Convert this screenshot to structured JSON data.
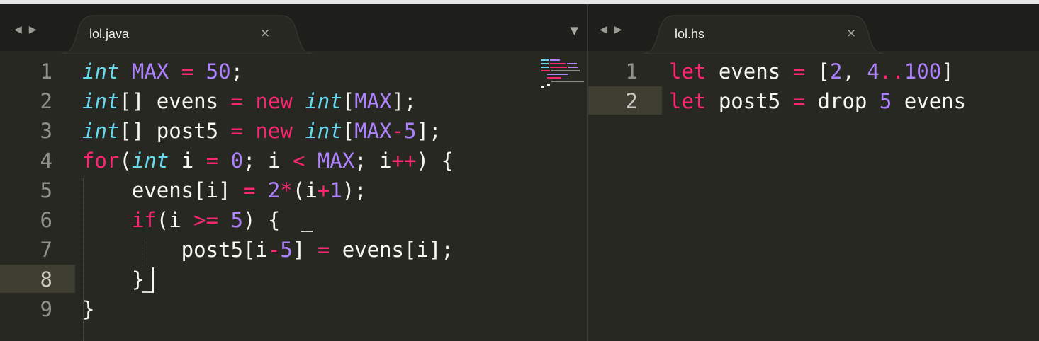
{
  "left_pane": {
    "tab_title": "lol.java",
    "close_glyph": "×",
    "nav_back_glyph": "◀",
    "nav_forward_glyph": "▶",
    "dropdown_glyph": "▼",
    "line_numbers": [
      "1",
      "2",
      "3",
      "4",
      "5",
      "6",
      "7",
      "8",
      "9"
    ],
    "current_line": "8"
  },
  "right_pane": {
    "tab_title": "lol.hs",
    "close_glyph": "×",
    "nav_back_glyph": "◀",
    "nav_forward_glyph": "▶",
    "line_numbers": [
      "1",
      "2"
    ],
    "current_line": "2"
  },
  "java_code": {
    "l1": {
      "t1": "int",
      "t2": " ",
      "t3": "MAX",
      "t4": " ",
      "t5": "=",
      "t6": " ",
      "t7": "50",
      "t8": ";"
    },
    "l2": {
      "t1": "int",
      "t2": "[] evens ",
      "t3": "=",
      "t4": " ",
      "t5": "new",
      "t6": " ",
      "t7": "int",
      "t8": "[",
      "t9": "MAX",
      "t10": "];"
    },
    "l3": {
      "t1": "int",
      "t2": "[] post5 ",
      "t3": "=",
      "t4": " ",
      "t5": "new",
      "t6": " ",
      "t7": "int",
      "t8": "[",
      "t9": "MAX",
      "t10": "-",
      "t11": "5",
      "t12": "];"
    },
    "l4": {
      "t1": "for",
      "t2": "(",
      "t3": "int",
      "t4": " i ",
      "t5": "=",
      "t6": " ",
      "t7": "0",
      "t8": "; i ",
      "t9": "<",
      "t10": " ",
      "t11": "MAX",
      "t12": "; i",
      "t13": "++",
      "t14": ") {"
    },
    "l5": {
      "t1": "    evens[i] ",
      "t2": "=",
      "t3": " ",
      "t4": "2",
      "t5": "*",
      "t6": "(i",
      "t7": "+",
      "t8": "1",
      "t9": ");"
    },
    "l6": {
      "t1": "    ",
      "t2": "if",
      "t3": "(i ",
      "t4": ">=",
      "t5": " ",
      "t6": "5",
      "t7": ") {"
    },
    "l7": {
      "t1": "        post5[i",
      "t2": "-",
      "t3": "5",
      "t4": "] ",
      "t5": "=",
      "t6": " evens[i];"
    },
    "l8": {
      "t1": "    }"
    },
    "l9": {
      "t1": "}"
    }
  },
  "hs_code": {
    "l1": {
      "t1": "let",
      "t2": " evens ",
      "t3": "=",
      "t4": " [",
      "t5": "2",
      "t6": ", ",
      "t7": "4",
      "t8": "..",
      "t9": "100",
      "t10": "]"
    },
    "l2": {
      "t1": "let",
      "t2": " post5 ",
      "t3": "=",
      "t4": " drop ",
      "t5": "5",
      "t6": " evens"
    }
  },
  "colors": {
    "background": "#272822",
    "keyword": "#f92672",
    "type": "#66d9ef",
    "number": "#ae81ff",
    "text": "#f8f8f2",
    "current_line": "#3e3d32"
  }
}
